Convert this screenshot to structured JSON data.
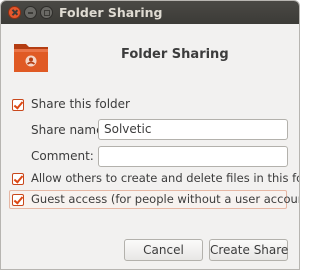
{
  "window": {
    "title": "Folder Sharing"
  },
  "header": {
    "icon": "shared-folder-icon",
    "heading": "Folder Sharing"
  },
  "options": {
    "share_folder": {
      "label": "Share this folder",
      "checked": true
    },
    "allow_others": {
      "label": "Allow others to create and delete files in this folder",
      "checked": true
    },
    "guest_access": {
      "label": "Guest access (for people without a user account)",
      "checked": true
    }
  },
  "form": {
    "share_name_label": "Share name:",
    "share_name_value": "Solvetic",
    "comment_label": "Comment:",
    "comment_value": ""
  },
  "buttons": {
    "cancel": "Cancel",
    "create_share": "Create Share"
  },
  "colors": {
    "accent": "#dd4814",
    "titlebar": "#3c3b37",
    "background": "#f2f1f0"
  }
}
